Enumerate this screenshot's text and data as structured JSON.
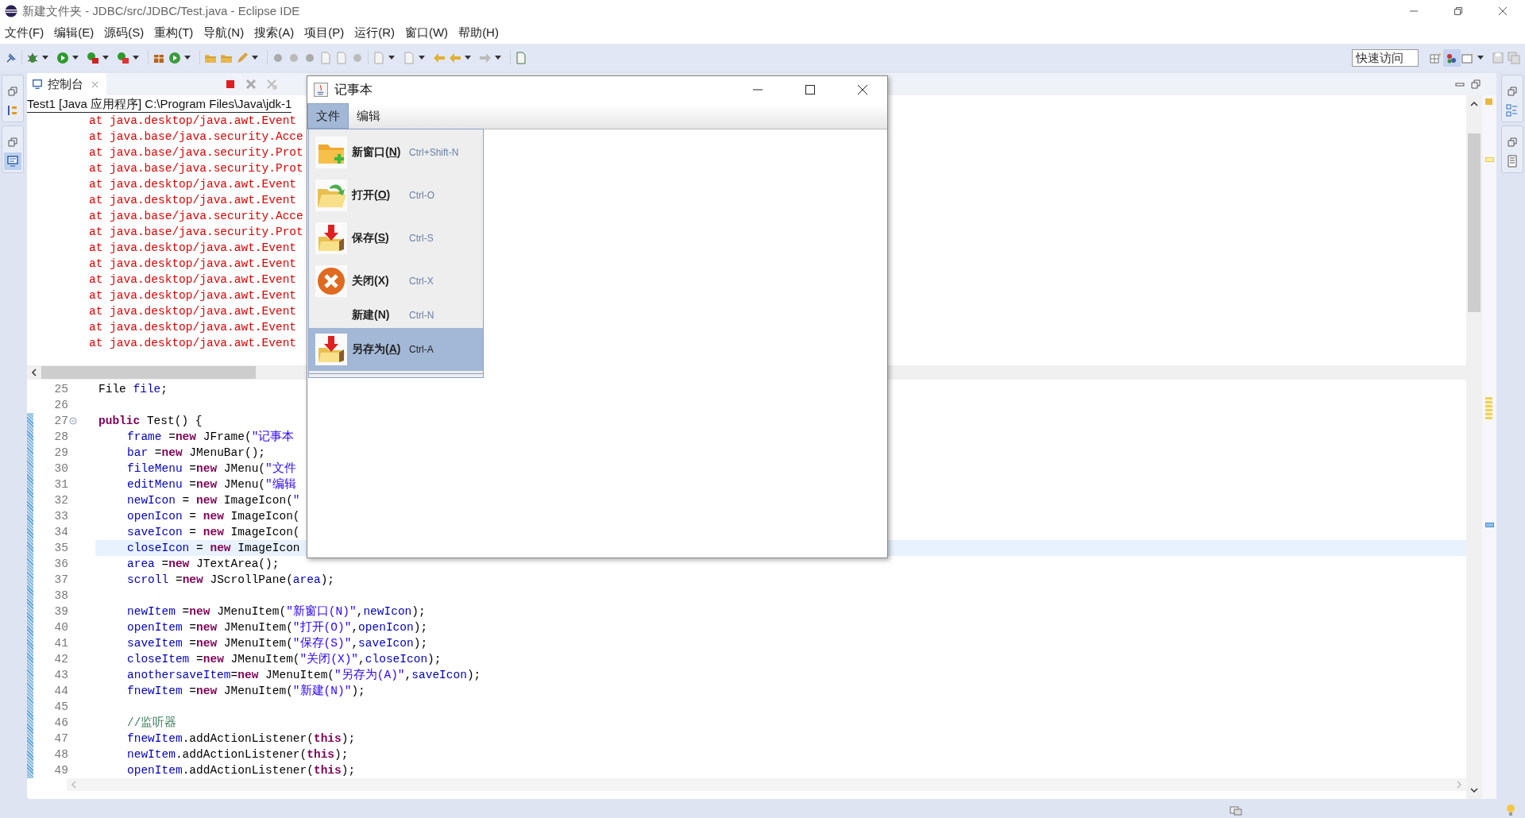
{
  "window": {
    "title": "新建文件夹 - JDBC/src/JDBC/Test.java - Eclipse IDE"
  },
  "menu": [
    "文件(F)",
    "编辑(E)",
    "源码(S)",
    "重构(T)",
    "导航(N)",
    "搜索(A)",
    "项目(P)",
    "运行(R)",
    "窗口(W)",
    "帮助(H)"
  ],
  "quick_access": {
    "placeholder": "快速访问"
  },
  "console": {
    "tab": {
      "label": "控制台",
      "selected": true
    },
    "header": "Test1 [Java 应用程序] C:\\Program Files\\Java\\jdk-1",
    "lines": [
      "at java.desktop/java.awt.Event",
      "at java.base/java.security.Acce",
      "at java.base/java.security.Prot",
      "at java.base/java.security.Prot",
      "at java.desktop/java.awt.Event",
      "at java.desktop/java.awt.Event",
      "at java.base/java.security.Acce",
      "at java.base/java.security.Prot",
      "at java.desktop/java.awt.Event",
      "at java.desktop/java.awt.Event",
      "at java.desktop/java.awt.Event",
      "at java.desktop/java.awt.Event",
      "at java.desktop/java.awt.Event",
      "at java.desktop/java.awt.Event",
      "at java.desktop/java.awt.Event"
    ]
  },
  "editor": {
    "lines": [
      {
        "number": "25",
        "current": false,
        "segments": [
          {
            "kind": "plain",
            "text": "File "
          },
          {
            "kind": "field",
            "text": "file"
          },
          {
            "kind": "plain",
            "text": ";"
          }
        ]
      },
      {
        "number": "26",
        "current": false
      },
      {
        "number": "27",
        "current": false,
        "expanded": true,
        "segments": [
          {
            "kind": "kw",
            "text": "public"
          },
          {
            "kind": "plain",
            "text": " Test() {"
          }
        ],
        "children": [
          {
            "number": "28",
            "current": false,
            "segments": [
              {
                "kind": "field",
                "text": "frame"
              },
              {
                "kind": "plain",
                "text": " ="
              },
              {
                "kind": "kw",
                "text": "new"
              },
              {
                "kind": "plain",
                "text": " JFrame("
              },
              {
                "kind": "str",
                "text": "\"记事本"
              }
            ]
          },
          {
            "number": "29",
            "current": false,
            "segments": [
              {
                "kind": "field",
                "text": "bar"
              },
              {
                "kind": "plain",
                "text": " ="
              },
              {
                "kind": "kw",
                "text": "new"
              },
              {
                "kind": "plain",
                "text": " JMenuBar();"
              }
            ]
          },
          {
            "number": "30",
            "current": false,
            "segments": [
              {
                "kind": "field",
                "text": "fileMenu"
              },
              {
                "kind": "plain",
                "text": " ="
              },
              {
                "kind": "kw",
                "text": "new"
              },
              {
                "kind": "plain",
                "text": " JMenu("
              },
              {
                "kind": "str",
                "text": "\"文件"
              }
            ]
          },
          {
            "number": "31",
            "current": false,
            "segments": [
              {
                "kind": "field",
                "text": "editMenu"
              },
              {
                "kind": "plain",
                "text": " ="
              },
              {
                "kind": "kw",
                "text": "new"
              },
              {
                "kind": "plain",
                "text": " JMenu("
              },
              {
                "kind": "str",
                "text": "\"编辑"
              }
            ]
          },
          {
            "number": "32",
            "current": false,
            "segments": [
              {
                "kind": "field",
                "text": "newIcon"
              },
              {
                "kind": "plain",
                "text": " = "
              },
              {
                "kind": "kw",
                "text": "new"
              },
              {
                "kind": "plain",
                "text": " ImageIcon("
              },
              {
                "kind": "str",
                "text": "\""
              }
            ]
          },
          {
            "number": "33",
            "current": false,
            "segments": [
              {
                "kind": "field",
                "text": "openIcon"
              },
              {
                "kind": "plain",
                "text": " = "
              },
              {
                "kind": "kw",
                "text": "new"
              },
              {
                "kind": "plain",
                "text": " ImageIcon("
              }
            ]
          },
          {
            "number": "34",
            "current": false,
            "segments": [
              {
                "kind": "field",
                "text": "saveIcon"
              },
              {
                "kind": "plain",
                "text": " = "
              },
              {
                "kind": "kw",
                "text": "new"
              },
              {
                "kind": "plain",
                "text": " ImageIcon("
              }
            ]
          },
          {
            "number": "35",
            "current": true,
            "segments": [
              {
                "kind": "field",
                "text": "closeIcon"
              },
              {
                "kind": "plain",
                "text": " = "
              },
              {
                "kind": "kw",
                "text": "new"
              },
              {
                "kind": "plain",
                "text": " ImageIcon"
              }
            ]
          },
          {
            "number": "36",
            "current": false,
            "segments": [
              {
                "kind": "field",
                "text": "area"
              },
              {
                "kind": "plain",
                "text": " ="
              },
              {
                "kind": "kw",
                "text": "new"
              },
              {
                "kind": "plain",
                "text": " JTextArea();"
              }
            ]
          },
          {
            "number": "37",
            "current": false,
            "segments": [
              {
                "kind": "field",
                "text": "scroll"
              },
              {
                "kind": "plain",
                "text": " ="
              },
              {
                "kind": "kw",
                "text": "new"
              },
              {
                "kind": "plain",
                "text": " JScrollPane("
              },
              {
                "kind": "field",
                "text": "area"
              },
              {
                "kind": "plain",
                "text": ");"
              }
            ]
          },
          {
            "number": "38",
            "current": false
          },
          {
            "number": "39",
            "current": false,
            "segments": [
              {
                "kind": "field",
                "text": "newItem"
              },
              {
                "kind": "plain",
                "text": " ="
              },
              {
                "kind": "kw",
                "text": "new"
              },
              {
                "kind": "plain",
                "text": " JMenuItem("
              },
              {
                "kind": "str",
                "text": "\"新窗口(N)\""
              },
              {
                "kind": "plain",
                "text": ","
              },
              {
                "kind": "field",
                "text": "newIcon"
              },
              {
                "kind": "plain",
                "text": ");"
              }
            ]
          },
          {
            "number": "40",
            "current": false,
            "segments": [
              {
                "kind": "field",
                "text": "openItem"
              },
              {
                "kind": "plain",
                "text": " ="
              },
              {
                "kind": "kw",
                "text": "new"
              },
              {
                "kind": "plain",
                "text": " JMenuItem("
              },
              {
                "kind": "str",
                "text": "\"打开(O)\""
              },
              {
                "kind": "plain",
                "text": ","
              },
              {
                "kind": "field",
                "text": "openIcon"
              },
              {
                "kind": "plain",
                "text": ");"
              }
            ]
          },
          {
            "number": "41",
            "current": false,
            "segments": [
              {
                "kind": "field",
                "text": "saveItem"
              },
              {
                "kind": "plain",
                "text": " ="
              },
              {
                "kind": "kw",
                "text": "new"
              },
              {
                "kind": "plain",
                "text": " JMenuItem("
              },
              {
                "kind": "str",
                "text": "\"保存(S)\""
              },
              {
                "kind": "plain",
                "text": ","
              },
              {
                "kind": "field",
                "text": "saveIcon"
              },
              {
                "kind": "plain",
                "text": ");"
              }
            ]
          },
          {
            "number": "42",
            "current": false,
            "segments": [
              {
                "kind": "field",
                "text": "closeItem"
              },
              {
                "kind": "plain",
                "text": " ="
              },
              {
                "kind": "kw",
                "text": "new"
              },
              {
                "kind": "plain",
                "text": " JMenuItem("
              },
              {
                "kind": "str",
                "text": "\"关闭(X)\""
              },
              {
                "kind": "plain",
                "text": ","
              },
              {
                "kind": "field",
                "text": "closeIcon"
              },
              {
                "kind": "plain",
                "text": ");"
              }
            ]
          },
          {
            "number": "43",
            "current": false,
            "segments": [
              {
                "kind": "field",
                "text": "anothersaveItem"
              },
              {
                "kind": "plain",
                "text": "="
              },
              {
                "kind": "kw",
                "text": "new"
              },
              {
                "kind": "plain",
                "text": " JMenuItem("
              },
              {
                "kind": "str",
                "text": "\"另存为(A)\""
              },
              {
                "kind": "plain",
                "text": ","
              },
              {
                "kind": "field",
                "text": "saveIcon"
              },
              {
                "kind": "plain",
                "text": ");"
              }
            ]
          },
          {
            "number": "44",
            "current": false,
            "segments": [
              {
                "kind": "field",
                "text": "fnewItem"
              },
              {
                "kind": "plain",
                "text": " ="
              },
              {
                "kind": "kw",
                "text": "new"
              },
              {
                "kind": "plain",
                "text": " JMenuItem("
              },
              {
                "kind": "str",
                "text": "\"新建(N)\""
              },
              {
                "kind": "plain",
                "text": ");"
              }
            ]
          },
          {
            "number": "45",
            "current": false
          },
          {
            "number": "46",
            "current": false,
            "segments": [
              {
                "kind": "comment",
                "text": "//监听器"
              }
            ]
          },
          {
            "number": "47",
            "current": false,
            "segments": [
              {
                "kind": "field",
                "text": "fnewItem"
              },
              {
                "kind": "plain",
                "text": ".addActionListener("
              },
              {
                "kind": "kw",
                "text": "this"
              },
              {
                "kind": "plain",
                "text": ");"
              }
            ]
          },
          {
            "number": "48",
            "current": false,
            "segments": [
              {
                "kind": "field",
                "text": "newItem"
              },
              {
                "kind": "plain",
                "text": ".addActionListener("
              },
              {
                "kind": "kw",
                "text": "this"
              },
              {
                "kind": "plain",
                "text": ");"
              }
            ]
          },
          {
            "number": "49",
            "current": false,
            "segments": [
              {
                "kind": "field",
                "text": "openItem"
              },
              {
                "kind": "plain",
                "text": ".addActionListener("
              },
              {
                "kind": "kw",
                "text": "this"
              },
              {
                "kind": "plain",
                "text": ");"
              }
            ]
          }
        ]
      }
    ]
  },
  "notepad": {
    "title": "记事本",
    "menus": [
      {
        "label": "文件",
        "selected": true
      },
      {
        "label": "编辑",
        "selected": false
      }
    ],
    "items": [
      {
        "kind": "new",
        "label": "新窗口(",
        "mnemonic": "N",
        "label_end": ")",
        "shortcut": "Ctrl+Shift-N",
        "selected": false
      },
      {
        "kind": "open",
        "label": "打开(",
        "mnemonic": "O",
        "label_end": ")",
        "shortcut": "Ctrl-O",
        "selected": false
      },
      {
        "kind": "save",
        "label": "保存(",
        "mnemonic": "S",
        "label_end": ")",
        "shortcut": "Ctrl-S",
        "selected": false
      },
      {
        "kind": "close",
        "label": "关闭(X)",
        "shortcut": "Ctrl-X",
        "selected": false
      },
      {
        "kind": "plain",
        "label": "新建(N)",
        "shortcut": "Ctrl-N",
        "selected": false
      },
      {
        "kind": "save",
        "label": "另存为(",
        "mnemonic": "A",
        "label_end": ")",
        "shortcut": "Ctrl-A",
        "selected": true
      }
    ]
  }
}
